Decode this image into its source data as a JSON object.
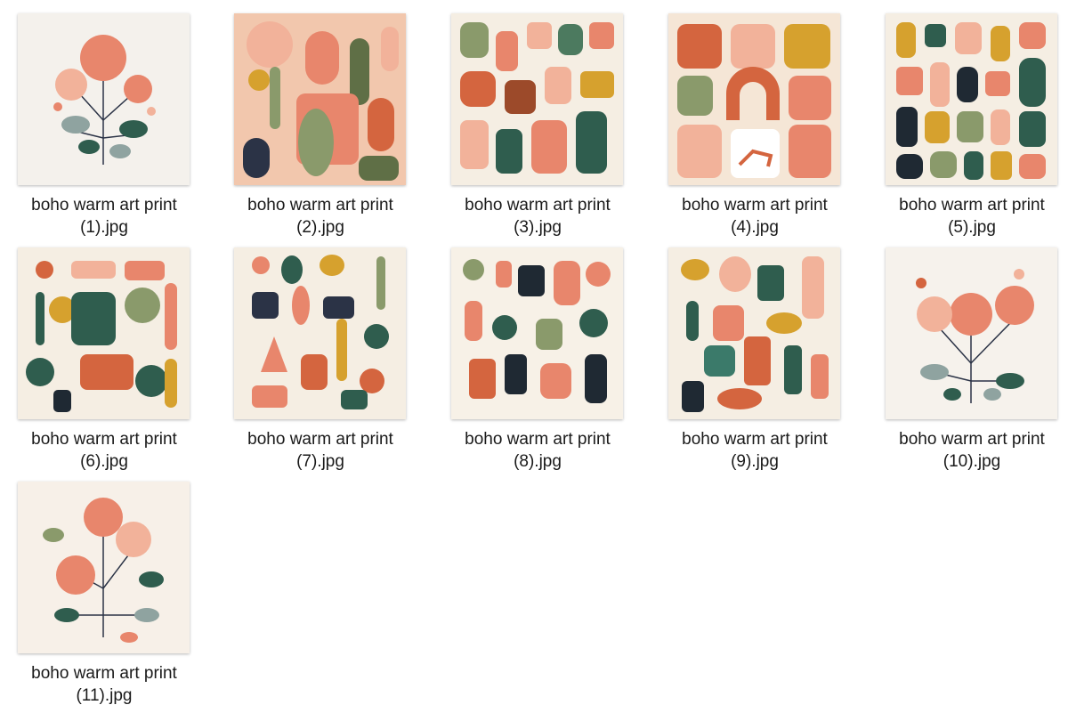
{
  "files": [
    {
      "line1": "boho warm art print",
      "line2": "(1).jpg"
    },
    {
      "line1": "boho warm art print",
      "line2": "(2).jpg"
    },
    {
      "line1": "boho warm art print",
      "line2": "(3).jpg"
    },
    {
      "line1": "boho warm art print",
      "line2": "(4).jpg"
    },
    {
      "line1": "boho warm art print",
      "line2": "(5).jpg"
    },
    {
      "line1": "boho warm art print",
      "line2": "(6).jpg"
    },
    {
      "line1": "boho warm art print",
      "line2": "(7).jpg"
    },
    {
      "line1": "boho warm art print",
      "line2": "(8).jpg"
    },
    {
      "line1": "boho warm art print",
      "line2": "(9).jpg"
    },
    {
      "line1": "boho warm art print",
      "line2": "(10).jpg"
    },
    {
      "line1": "boho warm art print",
      "line2": "(11).jpg"
    }
  ],
  "colors": {
    "coral": "#e8866c",
    "peach": "#f2b29a",
    "rust": "#d4653f",
    "sage": "#8a9a6b",
    "forest": "#2f5d4e",
    "mustard": "#d6a12e",
    "navy": "#2b3346",
    "cream": "#f5eee3"
  }
}
